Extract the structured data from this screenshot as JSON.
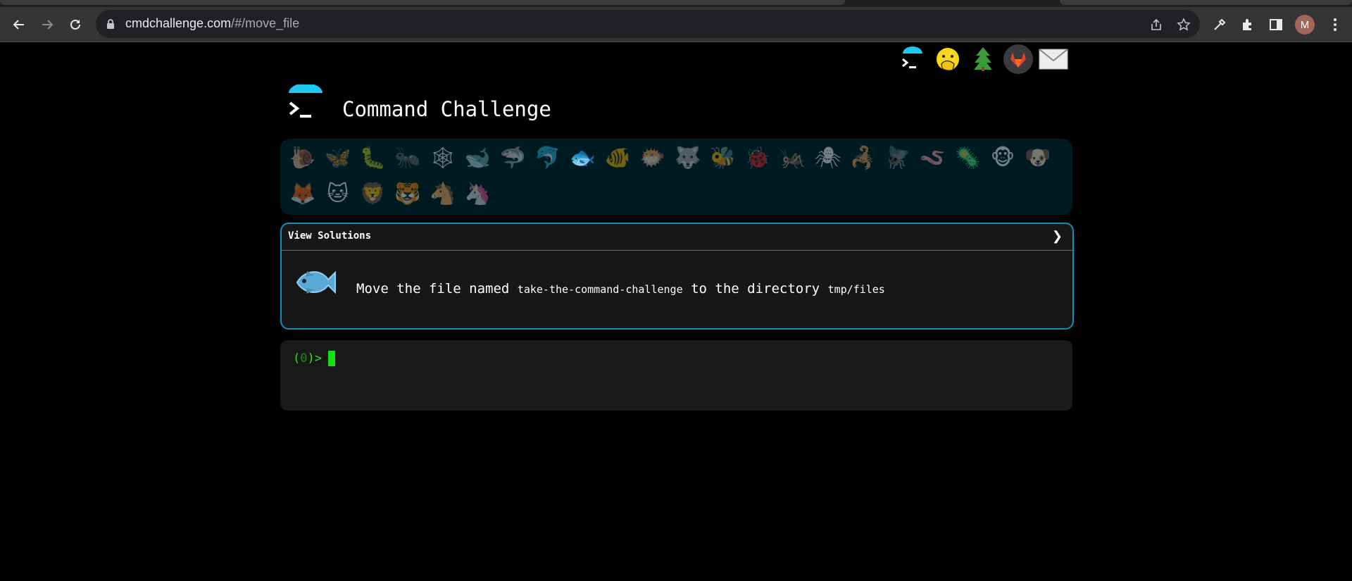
{
  "browser": {
    "url_host": "cmdchallenge.com",
    "url_path": "/#/move_file",
    "avatar_initial": "M",
    "icons": [
      "back-icon",
      "forward-icon",
      "reload-icon",
      "lock-icon",
      "share-icon",
      "bookmark-star-icon",
      "eyedropper-icon",
      "extensions-icon",
      "side-panel-icon",
      "menu-kebab-icon"
    ]
  },
  "page": {
    "title": "Command Challenge",
    "top_links": [
      "terminal-logo-link",
      "oops-emoji-link",
      "tree-link",
      "gitlab-link",
      "mail-link"
    ],
    "badges": {
      "row1": [
        "🐌",
        "🦋",
        "🐛",
        "🐜",
        "🕸",
        "🐋",
        "🦈",
        "🐬",
        "🐟",
        "🐠",
        "🐡",
        "🐺",
        "🐝",
        "🐞",
        "🦗",
        "🕷",
        "🦂",
        "🪰",
        "🪱",
        "🦠",
        "🐵",
        "🐶"
      ],
      "row2": [
        "🦊",
        "🐱",
        "🦁",
        "🐯",
        "🐴",
        "🦄"
      ],
      "earned_index": 8
    },
    "solutions": {
      "header": "View Solutions",
      "chevron": "❯",
      "challenge_emoji": "🐟",
      "text_prefix": "Move the file named",
      "file": "take-the-command-challenge",
      "text_middle": "to the directory",
      "dir": "tmp/files"
    },
    "terminal": {
      "prompt_open": "(",
      "prompt_num": "0",
      "prompt_close": ")>"
    }
  }
}
